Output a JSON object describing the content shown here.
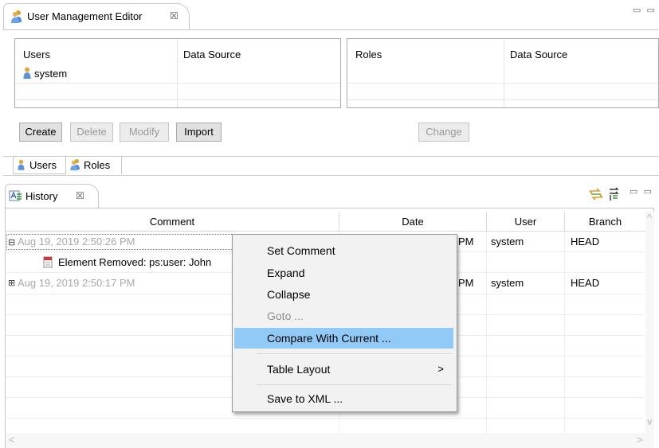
{
  "editor": {
    "tab_title": "User Management Editor",
    "tab_close": "☒",
    "minmax": "▭ ▭",
    "users_table": {
      "headers": [
        "Users",
        "Data Source"
      ],
      "rows": [
        [
          "system",
          ""
        ]
      ]
    },
    "roles_table": {
      "headers": [
        "Roles",
        "Data Source"
      ],
      "rows": []
    },
    "buttons": {
      "create": "Create",
      "delete": "Delete",
      "modify": "Modify",
      "import": "Import",
      "change": "Change"
    },
    "subtabs": [
      "Users",
      "Roles"
    ]
  },
  "history": {
    "tab_title": "History",
    "tab_close": "☒",
    "columns": [
      "Comment",
      "Date",
      "User",
      "Branch"
    ],
    "rows": [
      {
        "expander": "⊟",
        "comment": "Aug 19, 2019 2:50:26 PM",
        "date": "Aug 19, 2019 2:50:26 PM",
        "date_visible": "PM",
        "user": "system",
        "branch": "HEAD"
      },
      {
        "comment": "Element Removed: ps:user: John",
        "date": "",
        "user": "",
        "branch": ""
      },
      {
        "expander": "⊞",
        "comment": "Aug 19, 2019 2:50:17 PM",
        "date": "Aug 19, 2019 2:50:17 PM",
        "date_visible": "PM",
        "user": "system",
        "branch": "HEAD"
      }
    ],
    "scroll_left": "<",
    "scroll_right": ">",
    "scroll_up": "^",
    "scroll_down": "v"
  },
  "context_menu": {
    "items": [
      {
        "label": "Set Comment",
        "state": "normal"
      },
      {
        "label": "Expand",
        "state": "normal"
      },
      {
        "label": "Collapse",
        "state": "normal"
      },
      {
        "label": "Goto ...",
        "state": "disabled"
      },
      {
        "label": "Compare With Current ...",
        "state": "hover"
      },
      {
        "label": "Table Layout",
        "state": "normal",
        "submenu": ">"
      },
      {
        "label": "Save to XML ...",
        "state": "normal"
      }
    ]
  },
  "colors": {
    "menu_hover": "#91c9f7",
    "disabled_text": "#a9a9a9",
    "border": "#c7c7c7"
  }
}
